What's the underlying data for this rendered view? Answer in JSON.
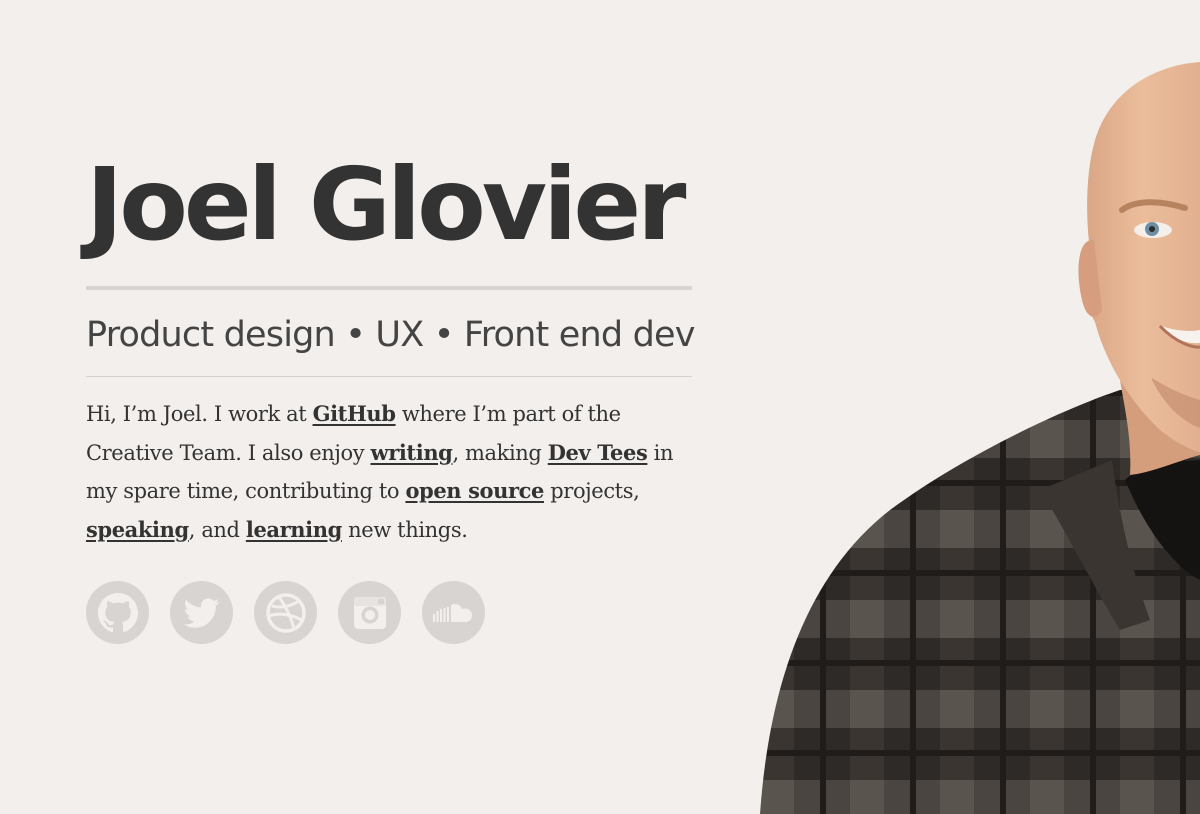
{
  "hero": {
    "name": "Joel Glovier",
    "tagline": "Product design • UX • Front end dev"
  },
  "bio": {
    "p1": "Hi, I’m Joel. I work at ",
    "github_link": "GitHub",
    "p2": " where I’m part of the Creative Team. I also enjoy ",
    "writing_link": "writing",
    "p3": ", making ",
    "devtees_link": "Dev Tees",
    "p4": " in my spare time, contributing to ",
    "opensource_link": "open source",
    "p5": " projects, ",
    "speaking_link": "speaking",
    "p6": ", and ",
    "learning_link": "learning",
    "p7": " new things."
  },
  "social": [
    {
      "icon": "github-icon"
    },
    {
      "icon": "twitter-icon"
    },
    {
      "icon": "dribbble-icon"
    },
    {
      "icon": "instagram-icon"
    },
    {
      "icon": "soundcloud-icon"
    }
  ],
  "colors": {
    "background": "#f3efec",
    "text": "#333333",
    "icon_gray": "#d8d4d1",
    "rule": "#d9d4d0"
  }
}
